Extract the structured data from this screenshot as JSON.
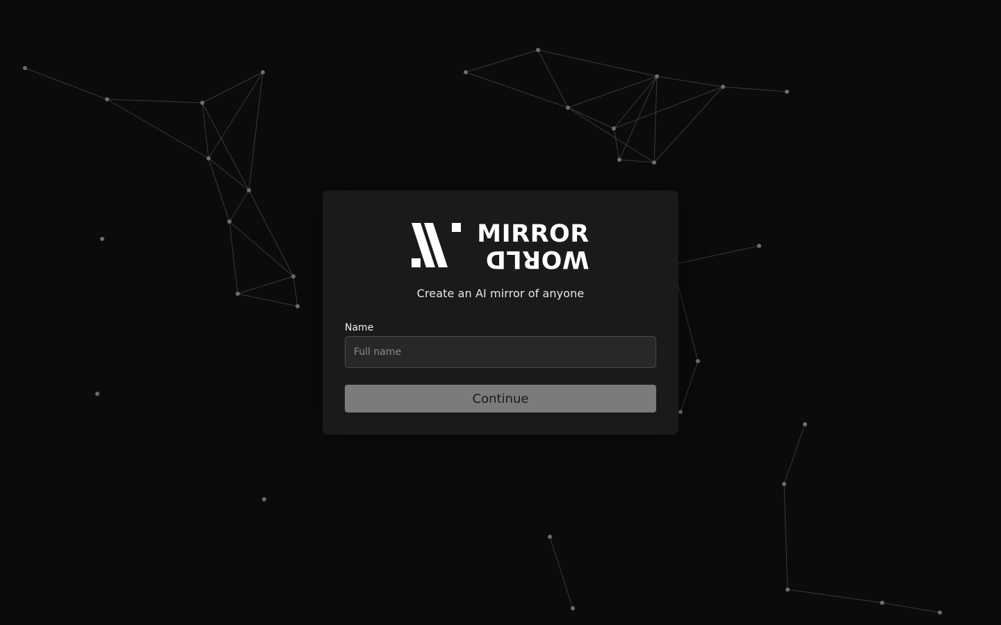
{
  "brand": {
    "name_top": "MIRROR",
    "name_bottom": "WORLD",
    "logo_icon": "mirror-world-logo-icon"
  },
  "tagline": "Create an AI mirror of anyone",
  "form": {
    "name_label": "Name",
    "name_placeholder": "Full name",
    "name_value": "",
    "continue_label": "Continue"
  },
  "colors": {
    "background": "#0b0b0b",
    "card": "#1a1a1a",
    "input_bg": "#282828",
    "button_bg": "#7b7b7b",
    "node": "#6e6e6e",
    "edge": "#3a3a3a"
  }
}
